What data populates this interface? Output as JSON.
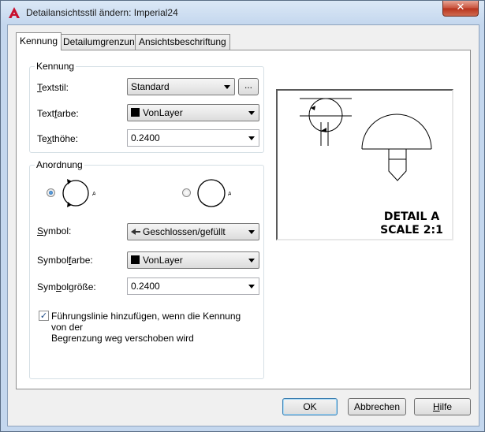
{
  "window": {
    "title": "Detailansichtsstil ändern: Imperial24",
    "close_glyph": "✕"
  },
  "tabs": [
    {
      "label": "Kennung",
      "active": true
    },
    {
      "label": "Detailumgrenzung",
      "active": false
    },
    {
      "label": "Ansichtsbeschriftung",
      "active": false
    }
  ],
  "kennung": {
    "group_label": "Kennung",
    "textstil": {
      "pre": "",
      "key": "T",
      "post": "extstil:",
      "value": "Standard",
      "browse_label": "..."
    },
    "textfarbe": {
      "pre": "Text",
      "key": "f",
      "post": "arbe:",
      "value": "VonLayer"
    },
    "texthoehe": {
      "pre": "Te",
      "key": "x",
      "post": "thöhe:",
      "value": "0.2400"
    }
  },
  "anordnung": {
    "group_label": "Anordnung",
    "option_1": {
      "selected": true,
      "letter": "A"
    },
    "option_2": {
      "selected": false,
      "letter": "A"
    },
    "symbol": {
      "pre": "",
      "key": "S",
      "post": "ymbol:",
      "value": "Geschlossen/gefüllt"
    },
    "symbolfarbe": {
      "pre": "Symbol",
      "key": "f",
      "post": "arbe:",
      "value": "VonLayer"
    },
    "symbolgroesse": {
      "pre": "Sym",
      "key": "b",
      "post": "olgröße:",
      "value": "0.2400"
    },
    "leader_checkbox": {
      "checked": true,
      "line1": "Führungslinie hinzufügen, wenn die Kennung von der",
      "line2": "Begrenzung weg verschoben wird"
    }
  },
  "preview": {
    "line1": "DETAIL A",
    "line2": "SCALE 2:1"
  },
  "buttons": {
    "ok": "OK",
    "cancel": "Abbrechen",
    "help_key": "H",
    "help_rest": "ilfe"
  },
  "colors": {
    "accent": "#3c7fb1",
    "title_bar": "#c4d7ee",
    "close_button": "#c7503a",
    "app_icon": "#c8102e"
  }
}
